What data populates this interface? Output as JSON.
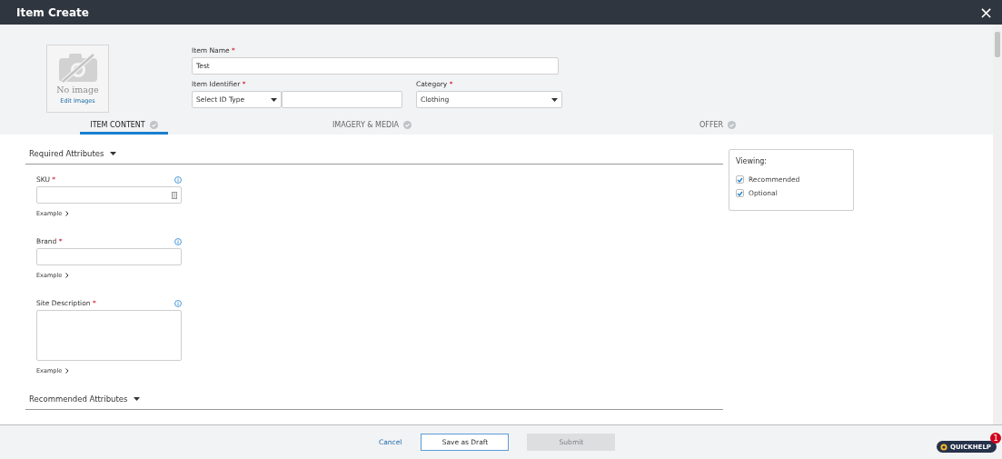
{
  "window": {
    "title": "Item Create",
    "close": "×"
  },
  "image": {
    "placeholder": "No image",
    "link": "Edit Images"
  },
  "item_name": {
    "label": "Item Name",
    "mark": "*",
    "value": "Test"
  },
  "item_identifier": {
    "label": "Item Identifier",
    "mark": "*",
    "select": "Select ID Type"
  },
  "category": {
    "label": "Category",
    "mark": "*",
    "value": "Clothing"
  },
  "tabs": [
    {
      "label": "ITEM CONTENT",
      "selected": true
    },
    {
      "label": "IMAGERY & MEDIA",
      "selected": false
    },
    {
      "label": "OFFER",
      "selected": false
    }
  ],
  "sections": [
    {
      "title": "Required Attributes",
      "fields": [
        {
          "label": "SKU",
          "mark": "*",
          "kind": "input",
          "has_icon": true,
          "example": "Example"
        },
        {
          "label": "Brand",
          "mark": "*",
          "kind": "input",
          "has_icon": false,
          "example": "Example"
        },
        {
          "label": "Site Description",
          "mark": "*",
          "kind": "textarea",
          "has_icon": false,
          "example": "Example"
        }
      ]
    },
    {
      "title": "Recommended Attributes"
    }
  ],
  "viewing": {
    "title": "Viewing:",
    "options": [
      {
        "label": "Recommended",
        "checked": true
      },
      {
        "label": "Optional",
        "checked": true
      }
    ]
  },
  "footer": {
    "cancel": "Cancel",
    "save": "Save as Draft",
    "submit": {
      "label": "Submit",
      "disabled": true
    }
  },
  "quickhelp": {
    "label": "QUICKHELP",
    "badge": "1"
  }
}
